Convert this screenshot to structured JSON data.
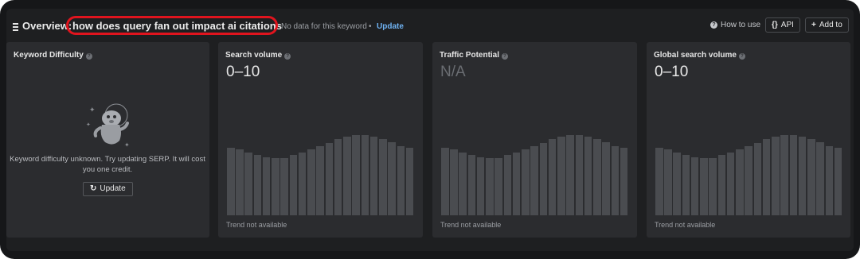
{
  "header": {
    "title_prefix": "Overview:",
    "keyword": "how does query fan out impact ai citations",
    "no_data_text": "No data for this keyword",
    "separator": "•",
    "update_label": "Update",
    "how_to_use_label": "How to use",
    "api_label": "API",
    "api_icon": "{}",
    "add_to_label": "Add to",
    "add_icon": "+",
    "highlight_color": "#e0141e"
  },
  "cards": {
    "keyword_difficulty": {
      "title": "Keyword Difficulty",
      "message": "Keyword difficulty unknown. Try updating SERP. It will cost you one credit.",
      "update_label": "Update",
      "update_icon": "refresh-icon"
    },
    "search_volume": {
      "title": "Search volume",
      "value": "0–10",
      "trend_text": "Trend not available",
      "trend_bars": [
        0.72,
        0.7,
        0.67,
        0.64,
        0.62,
        0.61,
        0.61,
        0.64,
        0.67,
        0.7,
        0.74,
        0.77,
        0.81,
        0.84,
        0.86,
        0.86,
        0.84,
        0.81,
        0.78,
        0.74,
        0.72
      ]
    },
    "traffic_potential": {
      "title": "Traffic Potential",
      "value": "N/A",
      "trend_text": "Trend not available",
      "trend_bars": [
        0.72,
        0.7,
        0.67,
        0.64,
        0.62,
        0.61,
        0.61,
        0.64,
        0.67,
        0.7,
        0.74,
        0.77,
        0.81,
        0.84,
        0.86,
        0.86,
        0.84,
        0.81,
        0.78,
        0.74,
        0.72
      ]
    },
    "global_search_volume": {
      "title": "Global search volume",
      "value": "0–10",
      "trend_text": "Trend not available",
      "trend_bars": [
        0.72,
        0.7,
        0.67,
        0.64,
        0.62,
        0.61,
        0.61,
        0.64,
        0.67,
        0.7,
        0.74,
        0.77,
        0.81,
        0.84,
        0.86,
        0.86,
        0.84,
        0.81,
        0.78,
        0.74,
        0.72
      ]
    }
  }
}
